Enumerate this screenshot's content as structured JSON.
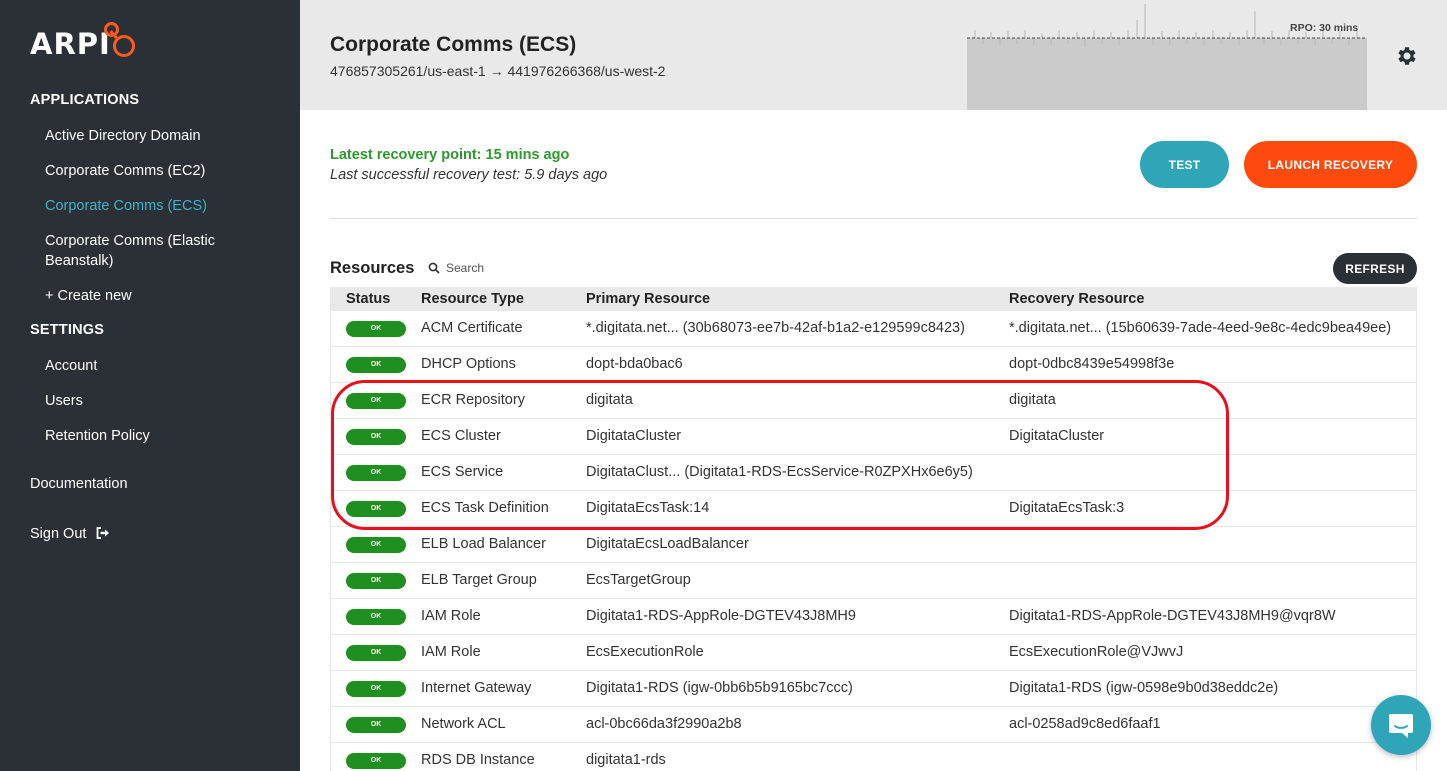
{
  "brand": {
    "logo_text": "ARPI"
  },
  "sidebar": {
    "applications_heading": "APPLICATIONS",
    "applications": [
      {
        "label": "Active Directory Domain",
        "active": false
      },
      {
        "label": "Corporate Comms (EC2)",
        "active": false
      },
      {
        "label": "Corporate Comms (ECS)",
        "active": true
      },
      {
        "label": "Corporate Comms (Elastic Beanstalk)",
        "active": false
      },
      {
        "label": "+ Create new",
        "active": false
      }
    ],
    "settings_heading": "SETTINGS",
    "settings": [
      {
        "label": "Account"
      },
      {
        "label": "Users"
      },
      {
        "label": "Retention Policy"
      }
    ],
    "documentation": "Documentation",
    "sign_out": "Sign Out"
  },
  "header": {
    "title": "Corporate Comms (ECS)",
    "subtitle": "476857305261/us-east-1 → 441976266368/us-west-2",
    "rpo_label": "RPO: 30 mins"
  },
  "recovery": {
    "latest_point": "Latest recovery point: 15 mins ago",
    "last_test": "Last successful recovery test: 5.9 days ago",
    "test_label": "TEST",
    "launch_label": "LAUNCH RECOVERY"
  },
  "resources": {
    "title": "Resources",
    "search_placeholder": "Search",
    "refresh_label": "REFRESH",
    "columns": [
      "Status",
      "Resource Type",
      "Primary Resource",
      "Recovery Resource"
    ],
    "rows": [
      {
        "status": "OK",
        "type": "ACM Certificate",
        "primary": "*.digitata.net... (30b68073-ee7b-42af-b1a2-e129599c8423)",
        "recovery": "*.digitata.net... (15b60639-7ade-4eed-9e8c-4edc9bea49ee)"
      },
      {
        "status": "OK",
        "type": "DHCP Options",
        "primary": "dopt-bda0bac6",
        "recovery": "dopt-0dbc8439e54998f3e"
      },
      {
        "status": "OK",
        "type": "ECR Repository",
        "primary": "digitata",
        "recovery": "digitata"
      },
      {
        "status": "OK",
        "type": "ECS Cluster",
        "primary": "DigitataCluster",
        "recovery": "DigitataCluster"
      },
      {
        "status": "OK",
        "type": "ECS Service",
        "primary": "DigitataClust... (Digitata1-RDS-EcsService-R0ZPXHx6e6y5)",
        "recovery": ""
      },
      {
        "status": "OK",
        "type": "ECS Task Definition",
        "primary": "DigitataEcsTask:14",
        "recovery": "DigitataEcsTask:3"
      },
      {
        "status": "OK",
        "type": "ELB Load Balancer",
        "primary": "DigitataEcsLoadBalancer",
        "recovery": ""
      },
      {
        "status": "OK",
        "type": "ELB Target Group",
        "primary": "EcsTargetGroup",
        "recovery": ""
      },
      {
        "status": "OK",
        "type": "IAM Role",
        "primary": "Digitata1-RDS-AppRole-DGTEV43J8MH9",
        "recovery": "Digitata1-RDS-AppRole-DGTEV43J8MH9@vqr8W"
      },
      {
        "status": "OK",
        "type": "IAM Role",
        "primary": "EcsExecutionRole",
        "recovery": "EcsExecutionRole@VJwvJ"
      },
      {
        "status": "OK",
        "type": "Internet Gateway",
        "primary": "Digitata1-RDS (igw-0bb6b5b9165bc7ccc)",
        "recovery": "Digitata1-RDS (igw-0598e9b0d38eddc2e)"
      },
      {
        "status": "OK",
        "type": "Network ACL",
        "primary": "acl-0bc66da3f2990a2b8",
        "recovery": "acl-0258ad9c8ed6faaf1"
      },
      {
        "status": "OK",
        "type": "RDS DB Instance",
        "primary": "digitata1-rds",
        "recovery": ""
      }
    ]
  },
  "colors": {
    "sidebar_bg": "#2b2f36",
    "accent_teal": "#2ea6b8",
    "accent_orange": "#ff4a0d",
    "ok_green": "#1f8f1f",
    "highlight_red": "#e8101a"
  }
}
